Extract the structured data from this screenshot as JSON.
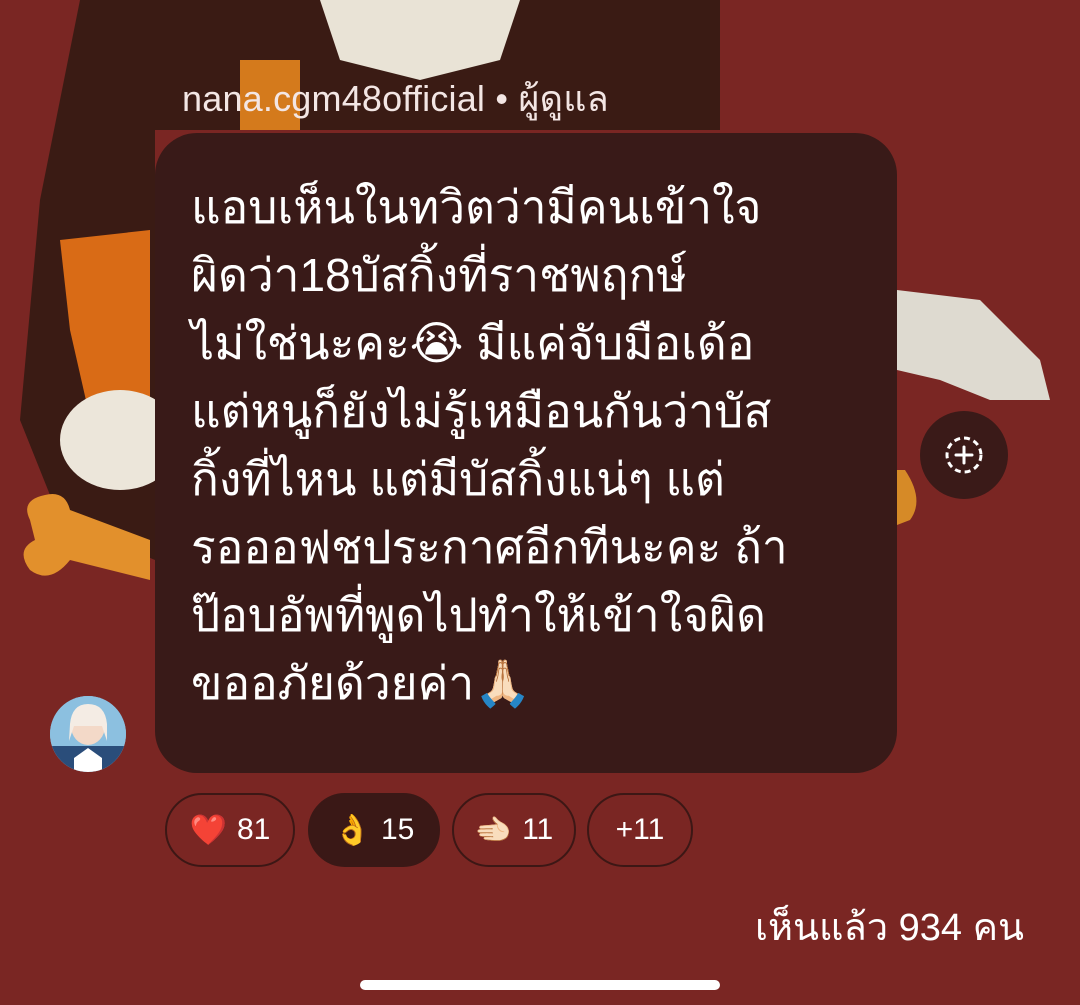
{
  "message": {
    "sender": "nana.cgm48official",
    "separator": "•",
    "role": "ผู้ดูแล",
    "lines": [
      "แอบเห็นในทวิตว่ามีคนเข้าใจ",
      "ผิดว่า18บัสกิ้งที่ราชพฤกษ์",
      "ไม่ใช่นะคะ😭 มีแค่จับมือเด้อ",
      "แต่หนูก็ยังไม่รู้เหมือนกันว่าบัส",
      "กิ้งที่ไหน แต่มีบัสกิ้งแน่ๆ แต่",
      "รอออฟชประกาศอีกทีนะคะ ถ้า",
      "ป๊อบอัพที่พูดไปทำให้เข้าใจผิด",
      "ขออภัยด้วยค่า🙏🏻"
    ]
  },
  "reactions": [
    {
      "emoji": "❤️",
      "count": "81",
      "active": false
    },
    {
      "emoji": "👌",
      "count": "15",
      "active": true
    },
    {
      "emoji": "🫲🏻",
      "count": "11",
      "active": false
    },
    {
      "emoji": "",
      "count": "+11",
      "active": false
    }
  ],
  "add_reaction_icon": "add-emoji-icon",
  "seen_text": "เห็นแล้ว 934 คน",
  "colors": {
    "background": "#7a2623",
    "bubble": "#391a18",
    "chip_border": "#3c1715"
  }
}
